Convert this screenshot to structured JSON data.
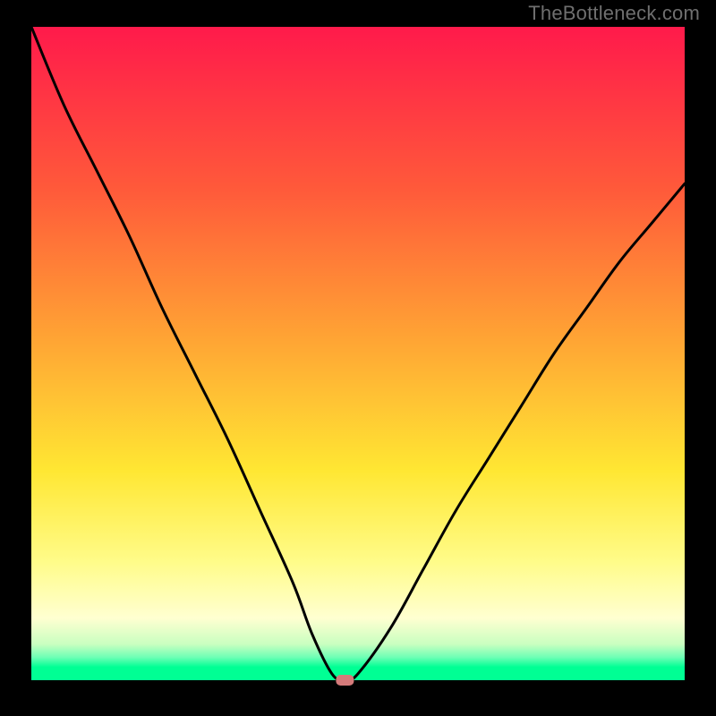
{
  "watermark": "TheBottleneck.com",
  "chart_data": {
    "type": "line",
    "title": "",
    "xlabel": "",
    "ylabel": "",
    "xlim": [
      0,
      100
    ],
    "ylim": [
      0,
      100
    ],
    "grid": false,
    "legend": false,
    "notes": "Bottleneck-style curve: V-shaped black line reaching 0% near x≈48; gradient background red→orange→yellow→green (top→bottom) represents high→low bottleneck.",
    "series": [
      {
        "name": "bottleneck-curve",
        "x": [
          0,
          5,
          10,
          15,
          20,
          25,
          30,
          35,
          40,
          43,
          46,
          48,
          50,
          55,
          60,
          65,
          70,
          75,
          80,
          85,
          90,
          95,
          100
        ],
        "y": [
          100,
          88,
          78,
          68,
          57,
          47,
          37,
          26,
          15,
          7,
          1,
          0,
          1,
          8,
          17,
          26,
          34,
          42,
          50,
          57,
          64,
          70,
          76
        ]
      }
    ],
    "marker": {
      "x": 48,
      "y": 0,
      "color": "#d47a7a"
    },
    "background_gradient_stops": [
      {
        "pos": 0.0,
        "color": "#ff1a4b"
      },
      {
        "pos": 0.25,
        "color": "#ff5a3a"
      },
      {
        "pos": 0.48,
        "color": "#ffa534"
      },
      {
        "pos": 0.68,
        "color": "#ffe733"
      },
      {
        "pos": 0.82,
        "color": "#fffc8a"
      },
      {
        "pos": 0.905,
        "color": "#ffffd1"
      },
      {
        "pos": 0.945,
        "color": "#c9ffc0"
      },
      {
        "pos": 0.965,
        "color": "#6dffb5"
      },
      {
        "pos": 0.98,
        "color": "#00ff94"
      },
      {
        "pos": 1.0,
        "color": "#00ff94"
      }
    ]
  }
}
